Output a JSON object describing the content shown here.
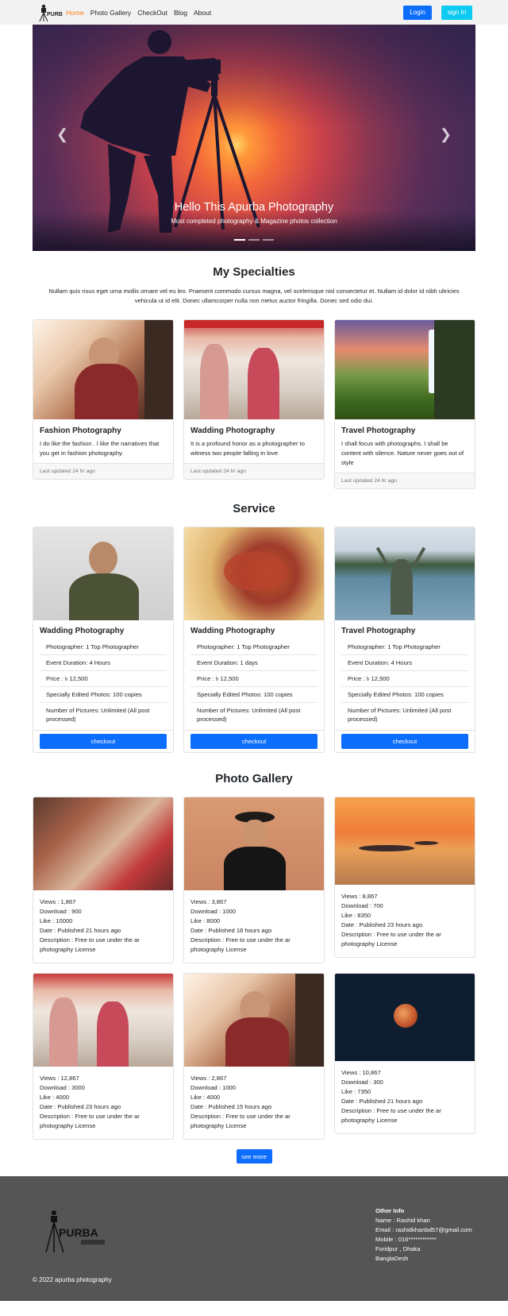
{
  "nav": {
    "links": [
      "Home",
      "Photo Gallery",
      "CheckOut",
      "Blog",
      "About"
    ],
    "login_label": "Login",
    "signin_label": "sign In",
    "active_color": "#fd7e14"
  },
  "hero": {
    "title": "Hello This Apurba Photography",
    "subtitle": "Most completed photography & Magazine photos collection",
    "prev_icon": "chevron-left-icon",
    "next_icon": "chevron-right-icon"
  },
  "specialties": {
    "title": "My Specialties",
    "text": "Nullam quis risus eget urna mollis ornare vel eu leo. Praesent commodo cursus magna, vel scelerisque nisl consectetur et. Nullam id dolor id nibh ultricies vehicula ut id elit. Donec ullamcorper nulla non metus auctor fringilla. Donec sed odio dui.",
    "cards": [
      {
        "title": "Fashion Photography",
        "text": "I do like the fashion . I like the narratives that you get in fashion photography.",
        "footer": "Last updated 24 hr ago"
      },
      {
        "title": "Wadding Photography",
        "text": "It is a profound honor as a photographer to witness two people falling in love",
        "footer": "Last updated 24 hr ago"
      },
      {
        "title": "Travel Photography",
        "text": "I shall focus with photographs. I shall be content with silence. Nature never goes out of style",
        "footer": "Last updated 24 hr ago"
      }
    ]
  },
  "service": {
    "title": "Service",
    "cards": [
      {
        "title": "Wadding Photography",
        "items": [
          "Photographer: 1 Top Photographer",
          "Event Duration: 4 Hours",
          "Price : ৳ 12,500",
          "Specially Edited Photos: 100 copies",
          "Number of Pictures: Unlimited (All post processed)"
        ],
        "button": "checkout"
      },
      {
        "title": "Wadding Photography",
        "items": [
          "Photographer: 1 Top Photographer",
          "Event Duration: 1 days",
          "Price : ৳ 12,500",
          "Specially Edited Photos: 100 copies",
          "Number of Pictures: Unlimited (All post processed)"
        ],
        "button": "checkout"
      },
      {
        "title": "Travel Photography",
        "items": [
          "Photographer: 1 Top Photographer",
          "Event Duration: 4 Hours",
          "Price : ৳ 12,500",
          "Specially Edited Photos: 100 copies",
          "Number of Pictures: Unlimited (All post processed)"
        ],
        "button": "checkout"
      }
    ]
  },
  "gallery": {
    "title": "Photo Gallery",
    "items": [
      {
        "views": "Views : 1,867",
        "download": "Download : 900",
        "like": "Like : 10000",
        "date": "Date : Published 21 hours ago",
        "description": "Description : Free to use under the ar photography License"
      },
      {
        "views": "Views : 3,867",
        "download": "Download : 1000",
        "like": "Like : 8000",
        "date": "Date : Published 18 hours ago",
        "description": "Description : Free to use under the ar photography License"
      },
      {
        "views": "Views : 8,867",
        "download": "Download : 700",
        "like": "Like : 8350",
        "date": "Date : Published 23 hours ago",
        "description": "Description : Free to use under the ar photography License"
      },
      {
        "views": "Views : 12,867",
        "download": "Download : 3000",
        "like": "Like : 4000",
        "date": "Date : Published 23 hours ago",
        "description": "Description : Free to use under the ar photography License"
      },
      {
        "views": "Views : 2,867",
        "download": "Download : 1000",
        "like": "Like : 4000",
        "date": "Date : Published 15 hours ago",
        "description": "Description : Free to use under the ar photography License"
      },
      {
        "views": "Views : 10,867",
        "download": "Download : 300",
        "like": "Like : 7350",
        "date": "Date : Published 21 hours ago",
        "description": "Description : Free to use under the ar photography License"
      }
    ],
    "see_more": "see more"
  },
  "footer": {
    "info_title": "Other Info",
    "name": "Name : Rashid khan",
    "email": "Email : rashidkhanbd57@gmail.com",
    "mobile": "Mobile : 016************",
    "city": "Foridpur , Dhaka",
    "country": "BanglaDesh",
    "copyright": "© 2022 apurba photography"
  },
  "colors": {
    "primary": "#0d6efd",
    "info": "#0dcaf0",
    "footer_bg": "#555555",
    "navbar_bg": "#f2f2f2"
  }
}
